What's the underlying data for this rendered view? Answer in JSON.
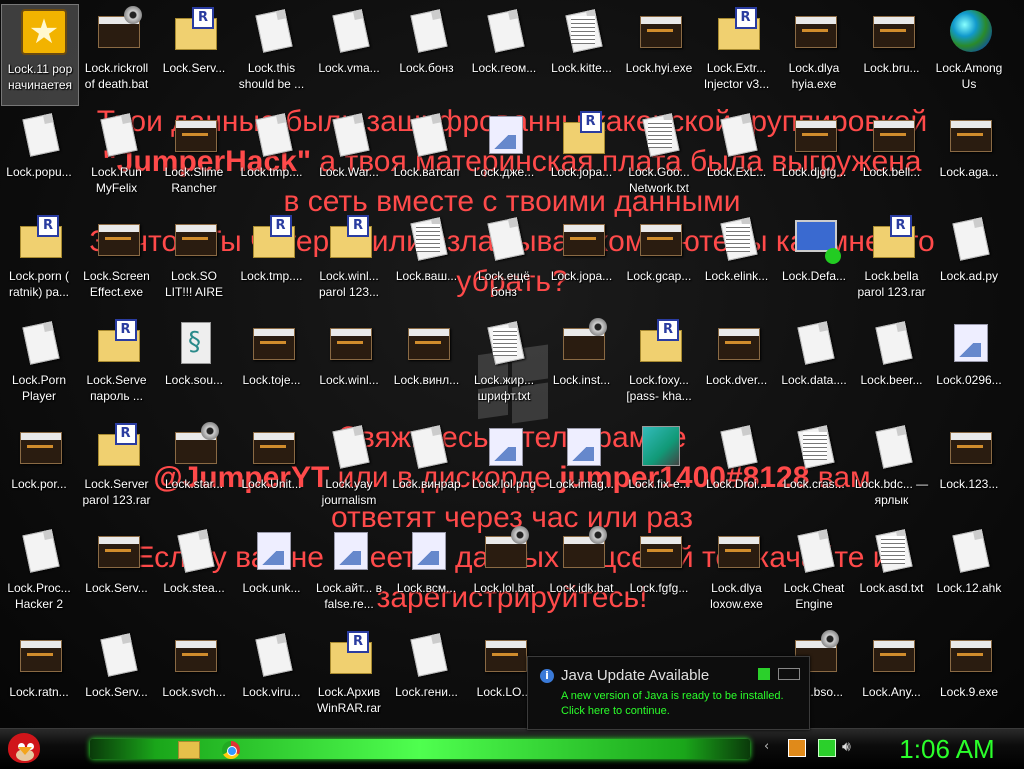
{
  "desktop": {
    "ransom_message": {
      "lines": [
        "Твои данные были зашифрованны хакерской группировкой",
        [
          "\"JumperHack\"",
          " а твоя материнская плата была выгружена"
        ],
        "в сеть вместе с твоими данными",
        "За что? Ты читерил или взламывал компьютеры как мне это",
        "убрать?",
        "",
        "",
        "",
        "Свяжитесь в телеграмме",
        [
          "@JumperYT",
          " или в дискорде ",
          "jumper1400#8128",
          " вам"
        ],
        "ответят через час или раз",
        "Если у вас не имеется данных соцсетей то скачайте и",
        "зарегистрируйтесь!"
      ],
      "color": "#ff4a4a"
    },
    "icons": [
      {
        "label": "Lock.11 рор начинаетея",
        "type": "star",
        "selected": true
      },
      {
        "label": "Lock.rickroll of death.bat",
        "type": "bat"
      },
      {
        "label": "Lock.Serv...",
        "type": "rar"
      },
      {
        "label": "Lock.this should be ...",
        "type": "doc"
      },
      {
        "label": "Lock.vma...",
        "type": "doc"
      },
      {
        "label": "Lock.бонз",
        "type": "doc"
      },
      {
        "label": "Lock.геом...",
        "type": "doc"
      },
      {
        "label": "Lock.kitte...",
        "type": "txt"
      },
      {
        "label": "Lock.hyi.exe",
        "type": "exe"
      },
      {
        "label": "Lock.Extr... Injector v3...",
        "type": "rar"
      },
      {
        "label": "Lock.dlya hyia.exe",
        "type": "exe"
      },
      {
        "label": "Lock.bru...",
        "type": "exe"
      },
      {
        "label": "Lock.Among Us",
        "type": "globe"
      },
      {
        "label": "Lock.popu...",
        "type": "doc"
      },
      {
        "label": "Lock.Run MyFelix",
        "type": "doc"
      },
      {
        "label": "Lock.Slime Rancher",
        "type": "exe"
      },
      {
        "label": "Lock.tmp....",
        "type": "doc"
      },
      {
        "label": "Lock.War...",
        "type": "doc"
      },
      {
        "label": "Lock.ватсап",
        "type": "doc"
      },
      {
        "label": "Lock.дже...",
        "type": "img"
      },
      {
        "label": "Lock.jopa...",
        "type": "rar"
      },
      {
        "label": "Lock.Goo... Network.txt",
        "type": "txt"
      },
      {
        "label": "Lock.ExL...",
        "type": "doc"
      },
      {
        "label": "Lock.djgfg...",
        "type": "exe"
      },
      {
        "label": "Lock.bell...",
        "type": "exe"
      },
      {
        "label": "Lock.aga...",
        "type": "exe"
      },
      {
        "label": "Lock.porn ( ratnik) pa...",
        "type": "rar"
      },
      {
        "label": "Lock.Screen Effect.exe",
        "type": "exe"
      },
      {
        "label": "Lock.SO LIT!!! AIRE",
        "type": "exe"
      },
      {
        "label": "Lock.tmp....",
        "type": "rar"
      },
      {
        "label": "Lock.winl... parol 123...",
        "type": "rar"
      },
      {
        "label": "Lock.ваш...",
        "type": "txt"
      },
      {
        "label": "Lock.ещё бонз",
        "type": "doc"
      },
      {
        "label": "Lock.jopa...",
        "type": "exe"
      },
      {
        "label": "Lock.gcap...",
        "type": "exe"
      },
      {
        "label": "Lock.elink...",
        "type": "txt"
      },
      {
        "label": "Lock.Defa...",
        "type": "net"
      },
      {
        "label": "Lock.bella parol 123.rar",
        "type": "rar"
      },
      {
        "label": "Lock.ad.py",
        "type": "doc"
      },
      {
        "label": "Lock.Porn Player",
        "type": "doc"
      },
      {
        "label": "Lock.Serve пароль ...",
        "type": "rar"
      },
      {
        "label": "Lock.sou...",
        "type": "py"
      },
      {
        "label": "Lock.toje...",
        "type": "exe"
      },
      {
        "label": "Lock.winl...",
        "type": "exe"
      },
      {
        "label": "Lock.винл...",
        "type": "exe"
      },
      {
        "label": "Lock.жир... шрифт.txt",
        "type": "txt"
      },
      {
        "label": "Lock.inst...",
        "type": "bat"
      },
      {
        "label": "Lock.foxy... [pass- kha...",
        "type": "rar"
      },
      {
        "label": "Lock.dver...",
        "type": "exe"
      },
      {
        "label": "Lock.data....",
        "type": "doc"
      },
      {
        "label": "Lock.beer...",
        "type": "doc"
      },
      {
        "label": "Lock.0296...",
        "type": "img"
      },
      {
        "label": "Lock.por...",
        "type": "exe"
      },
      {
        "label": "Lock.Server parol 123.rar",
        "type": "rar"
      },
      {
        "label": "Lock.star...",
        "type": "bat"
      },
      {
        "label": "Lock.Unit...",
        "type": "exe"
      },
      {
        "label": "Lock.yay journalism",
        "type": "doc"
      },
      {
        "label": "Lock.винрар",
        "type": "doc"
      },
      {
        "label": "Lock.lol.png",
        "type": "img"
      },
      {
        "label": "Lock.imag...",
        "type": "img"
      },
      {
        "label": "Lock.fix-e...",
        "type": "reg"
      },
      {
        "label": "Lock.Droi...",
        "type": "doc"
      },
      {
        "label": "Lock.cras...",
        "type": "txt"
      },
      {
        "label": "Lock.bdc... — ярлык",
        "type": "doc"
      },
      {
        "label": "Lock.123...",
        "type": "exe"
      },
      {
        "label": "Lock.Proc... Hacker 2",
        "type": "doc"
      },
      {
        "label": "Lock.Serv...",
        "type": "exe"
      },
      {
        "label": "Lock.stea...",
        "type": "doc"
      },
      {
        "label": "Lock.unk...",
        "type": "img"
      },
      {
        "label": "Lock.айт... в false.re...",
        "type": "img"
      },
      {
        "label": "Lock.всм...",
        "type": "img"
      },
      {
        "label": "Lock.lol.bat",
        "type": "bat"
      },
      {
        "label": "Lock.idk.bat",
        "type": "bat"
      },
      {
        "label": "Lock.fgfg...",
        "type": "exe"
      },
      {
        "label": "Lock.dlya loxow.exe",
        "type": "exe"
      },
      {
        "label": "Lock.Cheat Engine",
        "type": "doc"
      },
      {
        "label": "Lock.asd.txt",
        "type": "txt"
      },
      {
        "label": "Lock.12.ahk",
        "type": "doc"
      },
      {
        "label": "Lock.ratn...",
        "type": "exe"
      },
      {
        "label": "Lock.Serv...",
        "type": "doc"
      },
      {
        "label": "Lock.svch...",
        "type": "exe"
      },
      {
        "label": "Lock.viru...",
        "type": "doc"
      },
      {
        "label": "Lock.Архив WinRAR.rar",
        "type": "rar"
      },
      {
        "label": "Lock.гени...",
        "type": "doc"
      },
      {
        "label": "Lock.LO...",
        "type": "exe"
      },
      {
        "label": "",
        "type": "none"
      },
      {
        "label": "",
        "type": "none"
      },
      {
        "label": "",
        "type": "none"
      },
      {
        "label": "Lock.bso...",
        "type": "bat"
      },
      {
        "label": "Lock.Any...",
        "type": "exe"
      },
      {
        "label": "Lock.9.exe",
        "type": "exe"
      }
    ]
  },
  "notification": {
    "title": "Java Update Available",
    "message_line1": "A new version of Java is ready to be installed.",
    "message_line2": "Click here to continue.",
    "icon": "info-icon"
  },
  "taskbar": {
    "start_icon": "angry-bird-start-icon",
    "pinned": [
      "folder-icon",
      "chrome-icon"
    ],
    "tray_icons": [
      "chevron-icon",
      "java-update-icon",
      "network-icon",
      "volume-icon"
    ],
    "clock": "1:06 AM",
    "accent": "#2bff2b"
  }
}
